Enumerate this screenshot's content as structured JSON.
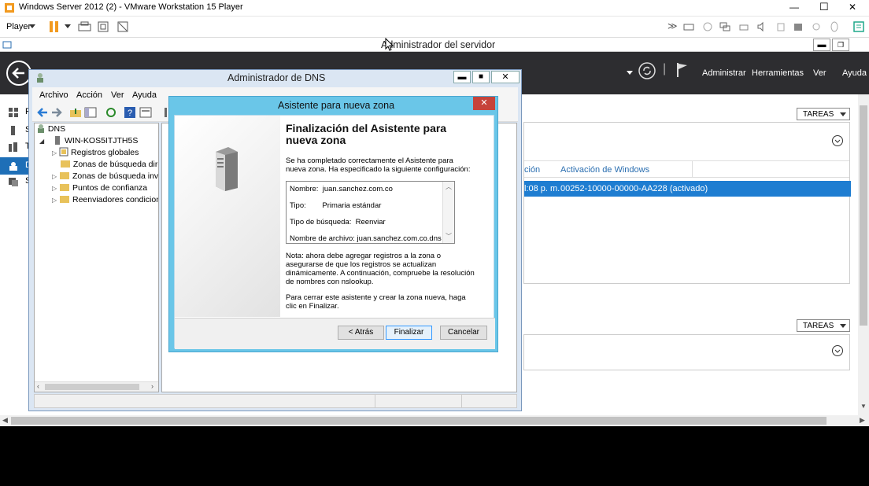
{
  "vm": {
    "title": "Windows Server 2012 (2) - VMware Workstation 15 Player",
    "player_label": "Player",
    "min_glyph": "—",
    "max_glyph": "☐",
    "close_glyph": "✕"
  },
  "server_manager": {
    "title": "Administrador del servidor",
    "nav": [
      "Administrar",
      "Herramientas",
      "Ver",
      "Ayuda"
    ],
    "tareas_label": "TAREAS",
    "table_headers": [
      "ción",
      "Activación de Windows"
    ],
    "selected_row": [
      "l:08 p. m.",
      "00252-10000-00000-AA228 (activado)"
    ],
    "sidebar_letters": [
      "P",
      "S",
      "T",
      "D",
      "S"
    ]
  },
  "dns_manager": {
    "title": "Administrador de DNS",
    "menu": [
      "Archivo",
      "Acción",
      "Ver",
      "Ayuda"
    ],
    "tree": {
      "root": "DNS",
      "server": "WIN-KOS5ITJTH5S",
      "children": [
        "Registros globales",
        "Zonas de búsqueda direc",
        "Zonas de búsqueda inver",
        "Puntos de confianza",
        "Reenviadores condiciona"
      ]
    }
  },
  "wizard": {
    "title": "Asistente para nueva zona",
    "heading": "Finalización del Asistente para nueva zona",
    "intro": "Se ha completado correctamente el Asistente para nueva zona. Ha especificado la siguiente configuración:",
    "config": {
      "name_label": "Nombre:",
      "name_value": "juan.sanchez.com.co",
      "type_label": "Tipo:",
      "type_value": "Primaria estándar",
      "lookup_label": "Tipo de búsqueda:",
      "lookup_value": "Reenviar",
      "file_label": "Nombre de archivo:",
      "file_value": "juan.sanchez.com.co.dns"
    },
    "note": "Nota: ahora debe agregar registros a la zona o asegurarse de que los registros se actualizan dinámicamente. A continuación, compruebe la resolución de nombres con nslookup.",
    "closing": "Para cerrar este asistente y crear la zona nueva, haga clic en Finalizar.",
    "buttons": {
      "back": "< Atrás",
      "finish": "Finalizar",
      "cancel": "Cancelar"
    }
  }
}
